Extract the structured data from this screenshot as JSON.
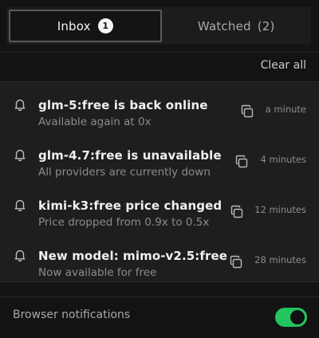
{
  "tabs": {
    "inbox_label": "Inbox",
    "inbox_badge": "1",
    "watched_label": "Watched",
    "watched_count": "(2)"
  },
  "clear_all_label": "Clear all",
  "notifications": [
    {
      "title": "glm-5:free is back online",
      "subtitle": "Available again at 0x",
      "time": "a minute",
      "icon": "bell-icon"
    },
    {
      "title": "glm-4.7:free is unavailable",
      "subtitle": "All providers are currently down",
      "time": "4 minutes",
      "icon": "bell-icon"
    },
    {
      "title": "kimi-k3:free price changed",
      "subtitle": "Price dropped from 0.9x to 0.5x",
      "time": "12 minutes",
      "icon": "bell-icon"
    },
    {
      "title": "New model: mimo-v2.5:free",
      "subtitle": "Now available for free",
      "time": "28 minutes",
      "icon": "bell-icon"
    }
  ],
  "browser_notifications": {
    "label": "Browser notifications",
    "enabled": true,
    "accent_color": "#22c55e"
  }
}
